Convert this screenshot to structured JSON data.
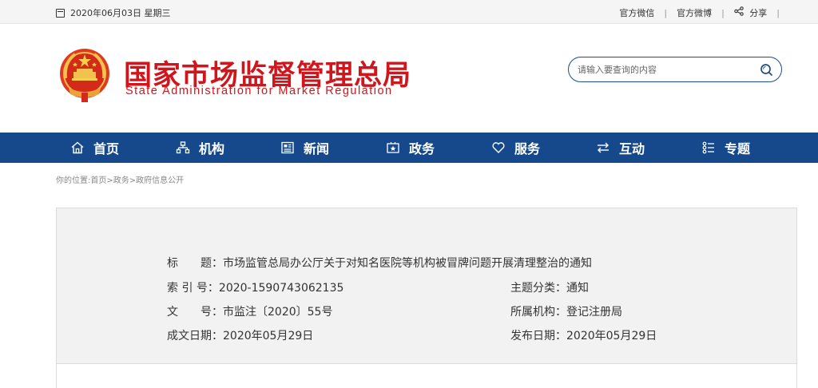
{
  "topbar": {
    "date": "2020年06月03日 星期三",
    "links": [
      "官方微信",
      "官方微博"
    ],
    "share_label": "分享",
    "separator": "|"
  },
  "header": {
    "title_cn": "国家市场监督管理总局",
    "title_en": "State Administration for Market Regulation",
    "search_placeholder": "请输入要查询的内容"
  },
  "nav": {
    "items": [
      {
        "label": "首页",
        "icon": "home-icon"
      },
      {
        "label": "机构",
        "icon": "org-chart-icon"
      },
      {
        "label": "新闻",
        "icon": "news-icon"
      },
      {
        "label": "政务",
        "icon": "government-affairs-icon"
      },
      {
        "label": "服务",
        "icon": "heart-icon"
      },
      {
        "label": "互动",
        "icon": "swap-arrows-icon"
      },
      {
        "label": "专题",
        "icon": "topics-icon"
      }
    ]
  },
  "breadcrumb": "你的位置:首页>政务>政府信息公开",
  "info": {
    "title_label": "标　　题：",
    "title_value": "市场监管总局办公厅关于对知名医院等机构被冒牌问题开展清理整治的通知",
    "index_label": "索 引 号：",
    "index_value": "2020-1590743062135",
    "topic_label": "主题分类：",
    "topic_value": "通知",
    "doc_label": "文　　号：",
    "doc_value": "市监注〔2020〕55号",
    "agency_label": "所属机构：",
    "agency_value": "登记注册局",
    "written_label": "成文日期：",
    "written_value": "2020年05月29日",
    "published_label": "发布日期：",
    "published_value": "2020年05月29日"
  },
  "colors": {
    "brand_red": "#d0161c",
    "nav_blue": "#16498c"
  }
}
